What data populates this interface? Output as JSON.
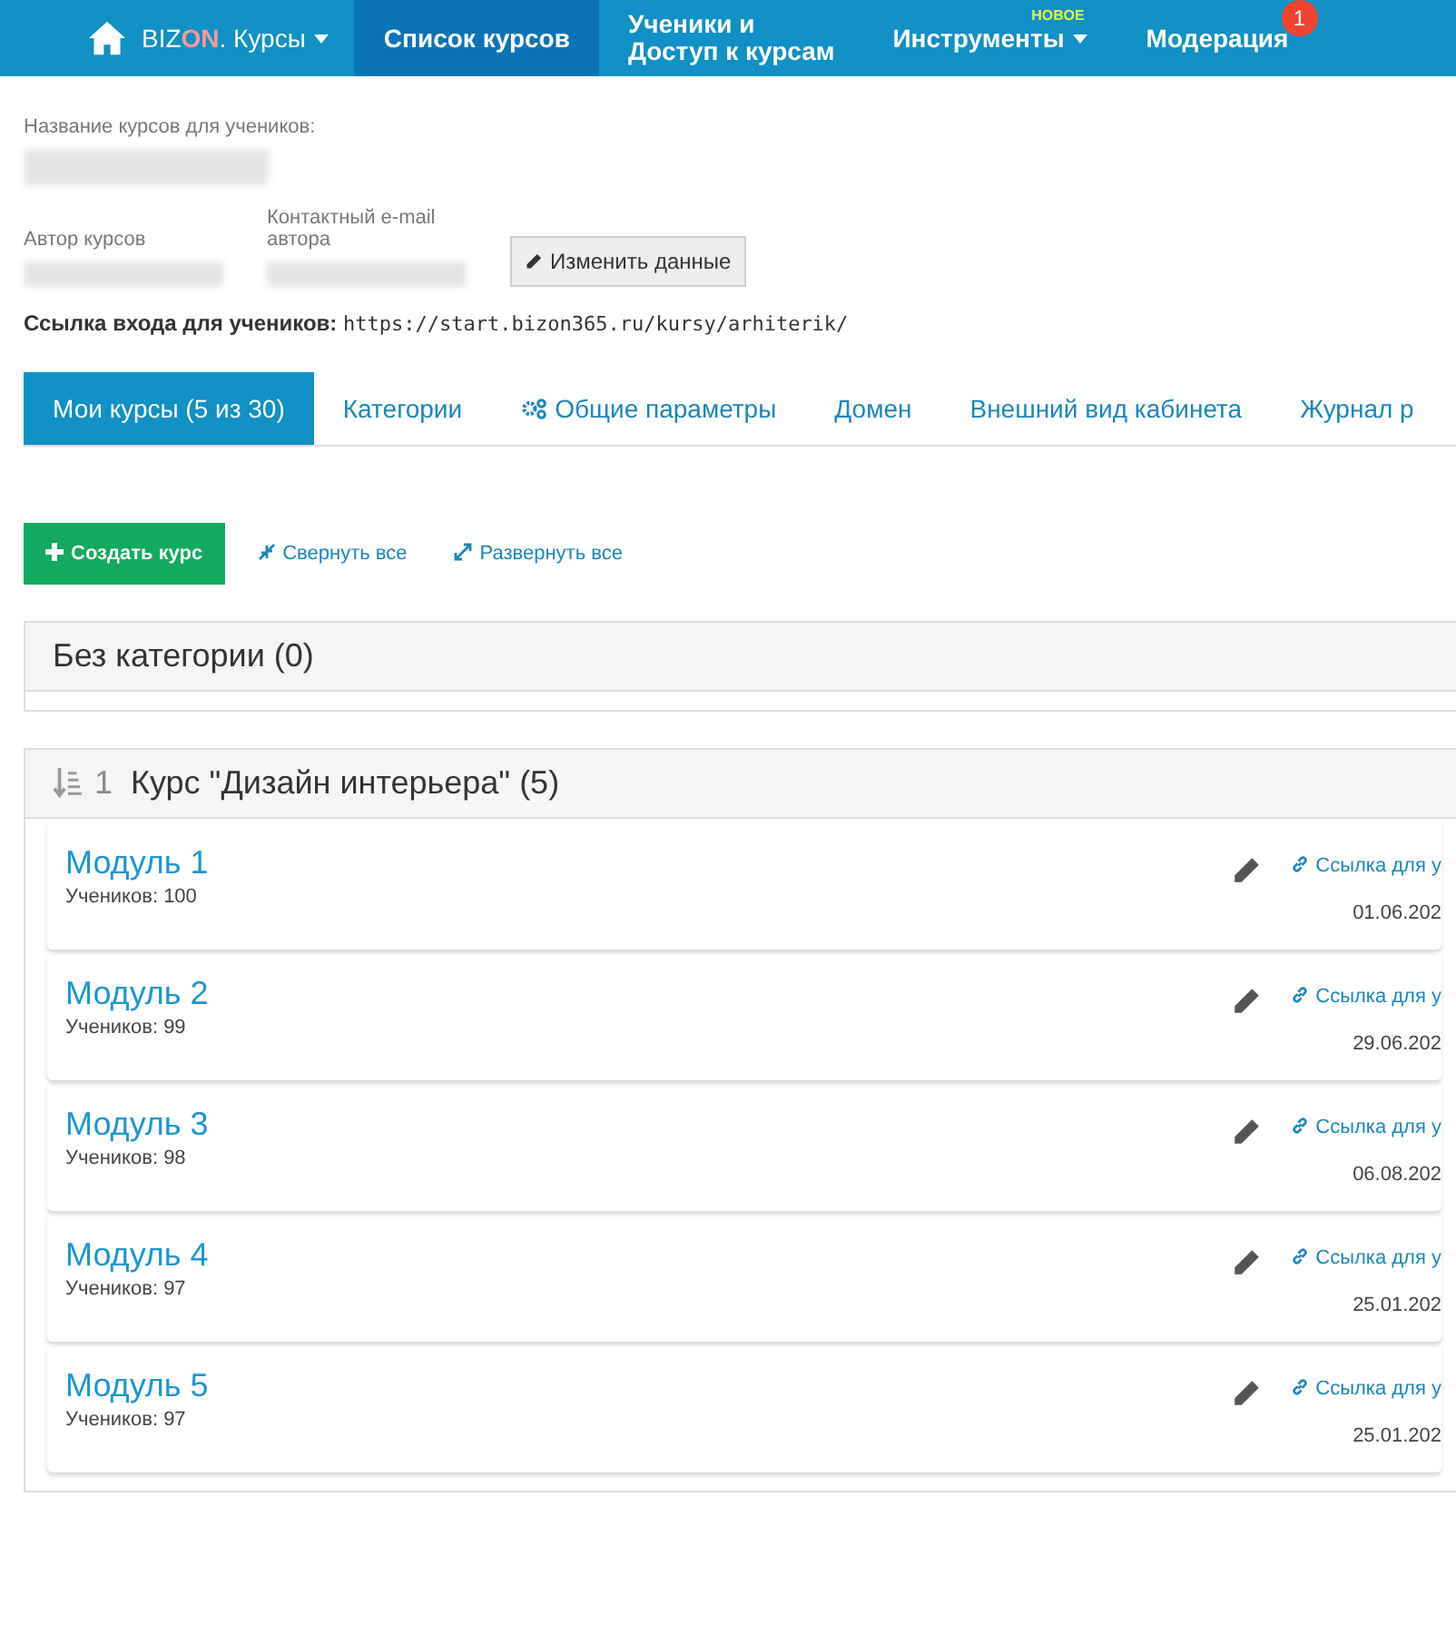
{
  "nav": {
    "brand_main": "BIZ",
    "brand_accent": "ON",
    "brand_rest": ". Курсы",
    "items": [
      {
        "label": "Список курсов",
        "selected": true,
        "kind": "link"
      },
      {
        "label": "Ученики и\nДоступ к курсам",
        "selected": false,
        "kind": "link"
      },
      {
        "label": "Инструменты",
        "selected": false,
        "kind": "dropdown",
        "note": "НОВОЕ"
      },
      {
        "label": "Модерация",
        "selected": false,
        "kind": "link",
        "badge": "1"
      }
    ]
  },
  "header": {
    "name_label": "Название курсов для учеников:",
    "author_label": "Автор курсов",
    "email_label": "Контактный e-mail автора",
    "edit_button": "Изменить данные",
    "link_label": "Ссылка входа для учеников:",
    "link_url": "https://start.bizon365.ru/kursy/arhiterik/"
  },
  "tabs": [
    {
      "label": "Мои курсы (5 из 30)",
      "selected": true,
      "kind": "plain"
    },
    {
      "label": "Категории",
      "selected": false,
      "kind": "plain"
    },
    {
      "label": "Общие параметры",
      "selected": false,
      "kind": "gears"
    },
    {
      "label": "Домен",
      "selected": false,
      "kind": "plain"
    },
    {
      "label": "Внешний вид кабинета",
      "selected": false,
      "kind": "plain"
    },
    {
      "label": "Журнал р",
      "selected": false,
      "kind": "plain"
    }
  ],
  "toolbar": {
    "create": "Создать курс",
    "collapse": "Свернуть все",
    "expand": "Развернуть все"
  },
  "categories": [
    {
      "kind": "uncategorized",
      "title": "Без категории (0)"
    },
    {
      "kind": "course",
      "number": "1",
      "title": "Курс \"Дизайн интерьера\" (5)",
      "modules": [
        {
          "title": "Модуль 1",
          "students": "Учеников: 100",
          "link": "Ссылка для у",
          "date": "01.06.202"
        },
        {
          "title": "Модуль 2",
          "students": "Учеников: 99",
          "link": "Ссылка для у",
          "date": "29.06.202"
        },
        {
          "title": "Модуль 3",
          "students": "Учеников: 98",
          "link": "Ссылка для у",
          "date": "06.08.202"
        },
        {
          "title": "Модуль 4",
          "students": "Учеников: 97",
          "link": "Ссылка для у",
          "date": "25.01.202"
        },
        {
          "title": "Модуль 5",
          "students": "Учеников: 97",
          "link": "Ссылка для у",
          "date": "25.01.202"
        }
      ]
    }
  ]
}
